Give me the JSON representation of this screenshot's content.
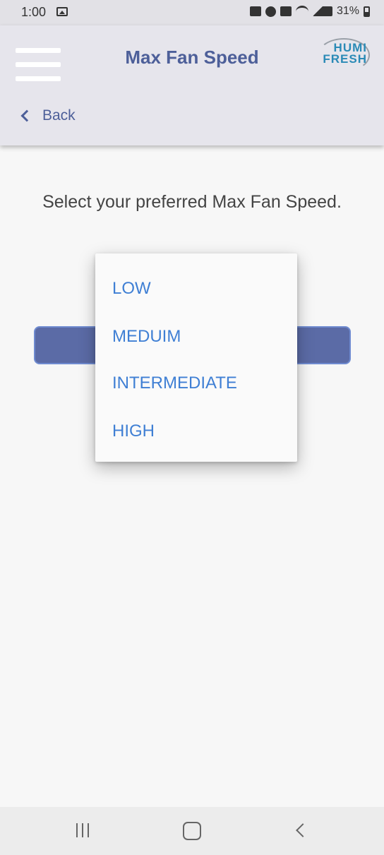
{
  "status_bar": {
    "time": "1:00",
    "battery": "31%",
    "icons": [
      "image-icon",
      "lock-icon",
      "alarm-icon",
      "mute-icon",
      "wifi-icon",
      "signal-icon",
      "battery-icon"
    ]
  },
  "header": {
    "title": "Max Fan Speed",
    "logo_line1": "HUMI",
    "logo_line2": "FRESH",
    "back_label": "Back"
  },
  "main": {
    "prompt": "Select your preferred Max Fan Speed.",
    "dropdown": {
      "options": [
        "LOW",
        "MEDUIM",
        "INTERMEDIATE",
        "HIGH"
      ]
    }
  },
  "colors": {
    "accent": "#4d5f99",
    "button": "#5b6ba6",
    "option_text": "#3f7fd4",
    "header_bg": "#e6e5ec"
  }
}
